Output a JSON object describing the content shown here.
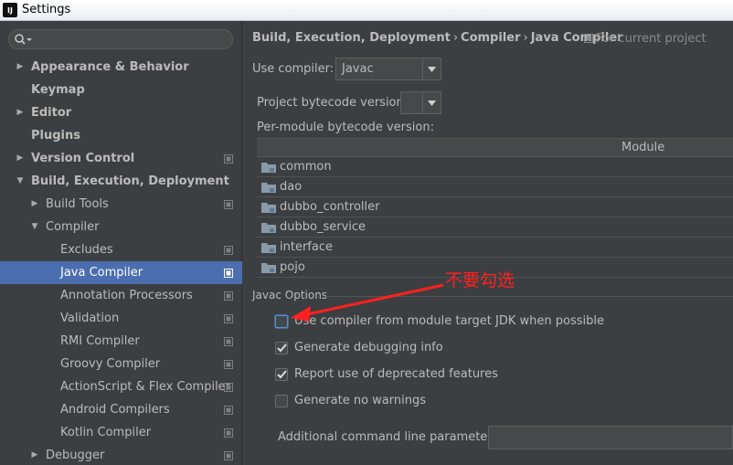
{
  "window": {
    "title": "Settings",
    "app_icon_text": "IJ"
  },
  "sidebar": {
    "search_placeholder": "",
    "items": [
      {
        "label": "Appearance & Behavior",
        "arrow": "▶",
        "bold": true
      },
      {
        "label": "Keymap",
        "arrow": "",
        "bold": true
      },
      {
        "label": "Editor",
        "arrow": "▶",
        "bold": true
      },
      {
        "label": "Plugins",
        "arrow": "",
        "bold": true
      },
      {
        "label": "Version Control",
        "arrow": "▶",
        "bold": true
      },
      {
        "label": "Build, Execution, Deployment",
        "arrow": "▼",
        "bold": true
      },
      {
        "label": "Build Tools",
        "arrow": "▶",
        "bold": false
      },
      {
        "label": "Compiler",
        "arrow": "▼",
        "bold": false
      },
      {
        "label": "Excludes",
        "arrow": "",
        "bold": false
      },
      {
        "label": "Java Compiler",
        "arrow": "",
        "bold": false,
        "selected": true
      },
      {
        "label": "Annotation Processors",
        "arrow": "",
        "bold": false
      },
      {
        "label": "Validation",
        "arrow": "",
        "bold": false
      },
      {
        "label": "RMI Compiler",
        "arrow": "",
        "bold": false
      },
      {
        "label": "Groovy Compiler",
        "arrow": "",
        "bold": false
      },
      {
        "label": "ActionScript & Flex Compiler",
        "arrow": "",
        "bold": false
      },
      {
        "label": "Android Compilers",
        "arrow": "",
        "bold": false
      },
      {
        "label": "Kotlin Compiler",
        "arrow": "",
        "bold": false
      },
      {
        "label": "Debugger",
        "arrow": "▶",
        "bold": false
      }
    ]
  },
  "breadcrumb": {
    "parts": [
      "Build, Execution, Deployment",
      "Compiler",
      "Java Compiler"
    ],
    "separator": "›",
    "scope": "For current project"
  },
  "compiler": {
    "label": "Use compiler:",
    "value": "Javac"
  },
  "bytecode": {
    "label": "Project bytecode version:",
    "value": ""
  },
  "per_module": {
    "label": "Per-module bytecode version:",
    "column_header": "Module",
    "modules": [
      "common",
      "dao",
      "dubbo_controller",
      "dubbo_service",
      "interface",
      "pojo"
    ]
  },
  "javac_options": {
    "title": "Javac Options",
    "checkboxes": [
      {
        "label": "Use compiler from module target JDK when possible",
        "checked": false
      },
      {
        "label": "Generate debugging info",
        "checked": true
      },
      {
        "label": "Report use of deprecated features",
        "checked": true
      },
      {
        "label": "Generate no warnings",
        "checked": false
      }
    ],
    "additional_params_label": "Additional command line parameters:",
    "additional_params_value": ""
  },
  "annotation": {
    "text": "不要勾选",
    "color": "#ff2020"
  },
  "colors": {
    "selection": "#4b6eaf",
    "background": "#3c3f41",
    "text": "#bbbbbb"
  }
}
